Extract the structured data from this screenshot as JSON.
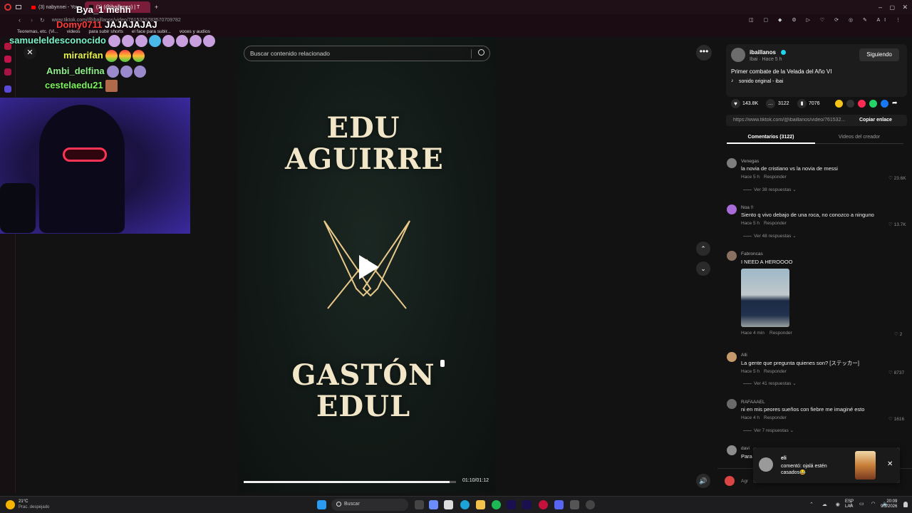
{
  "browser": {
    "tabs": [
      {
        "label": "(3) nabynnei - You"
      },
      {
        "label": "(1) (@ibaillanos) | T"
      }
    ],
    "url": "www.tiktok.com/@ibaillanos/video/761532678357070978​2",
    "bookmarks": [
      "Teoremas, etc. (Vi...",
      "videos",
      "para subir shorts",
      "el face para subir...",
      "voces y audios"
    ]
  },
  "chat": [
    {
      "user": "Bya_1",
      "msg": "mehh",
      "color": "#ffffff"
    },
    {
      "user": "Domy0711",
      "msg": "JAJAJAJAJ",
      "color": "#ff3b3b"
    },
    {
      "user": "samueleldesconocido",
      "msg": "",
      "color": "#7cf2c8"
    },
    {
      "user": "mirarifan",
      "msg": "",
      "color": "#e7f24a"
    },
    {
      "user": "Ambi_delfina",
      "msg": "",
      "color": "#8ff08a"
    },
    {
      "user": "cestelaedu21",
      "msg": "",
      "color": "#7bf25a"
    }
  ],
  "video": {
    "search_placeholder": "Buscar contenido relacionado",
    "fighter1_line1": "EDU",
    "fighter1_line2": "AGUIRRE",
    "fighter2_line1": "GASTÓN",
    "fighter2_line2": "EDUL",
    "time": "01:10/01:12",
    "progress": 0.97
  },
  "creator": {
    "name": "ibaillanos",
    "sub": "Ibai · Hace 5 h",
    "follow_label": "Siguiendo",
    "description": "Primer combate de la Velada del Año VI",
    "sound": "sonido original - ibai",
    "likes": "143.8K",
    "comments": "3122",
    "saves": "7076",
    "link": "https://www.tiktok.com/@ibaillanos/video/761532...",
    "copy_label": "Copiar enlace"
  },
  "tabs": {
    "comments": "Comentarios (3122)",
    "creator_videos": "Videos del creador"
  },
  "comments": [
    {
      "name": "Venegas",
      "text": "la novia de cristiano vs la novia de messi",
      "time": "Hace 5 h",
      "reply": "Responder",
      "likes": "23.6K",
      "replies": "Ver 38 respuestas"
    },
    {
      "name": "Noa !!",
      "text": "Siento q vivo debajo de una roca, no conozco a ninguno",
      "time": "Hace 5 h",
      "reply": "Responder",
      "likes": "13.7K",
      "replies": "Ver 48 respuestas"
    },
    {
      "name": "Fabroncas",
      "text": "I NEED A HEROOOO",
      "time": "Hace 4 min",
      "reply": "Responder",
      "likes": "2",
      "replies": ""
    },
    {
      "name": "Alli",
      "text": "La gente que pregunta quienes son? [ステッカー]",
      "time": "Hace 5 h",
      "reply": "Responder",
      "likes": "8737",
      "replies": "Ver 41 respuestas"
    },
    {
      "name": "RAFAAAEL",
      "text": "ni en mis peores sueños con fiebre me imaginé esto",
      "time": "Hace 4 h",
      "reply": "Responder",
      "likes": "1616",
      "replies": "Ver 7 respuestas"
    },
    {
      "name": "davi",
      "text": "Para",
      "time": "",
      "reply": "",
      "likes": "",
      "replies": ""
    }
  ],
  "comment_input": {
    "placeholder": "Agr"
  },
  "toast": {
    "user": "eli",
    "text": "comentó: ojalá estén casados😂"
  },
  "taskbar": {
    "weather_temp": "21°C",
    "weather_desc": "Prac. despejado",
    "search_label": "Buscar",
    "lang1": "ESP",
    "lang2": "LAA",
    "clock_time": "20:09",
    "clock_date": "9/3/2026"
  },
  "colors": {
    "accent": "#fe2c55",
    "follow_bg": "#2f2f2f",
    "tab_active": "#7a1d3a"
  }
}
